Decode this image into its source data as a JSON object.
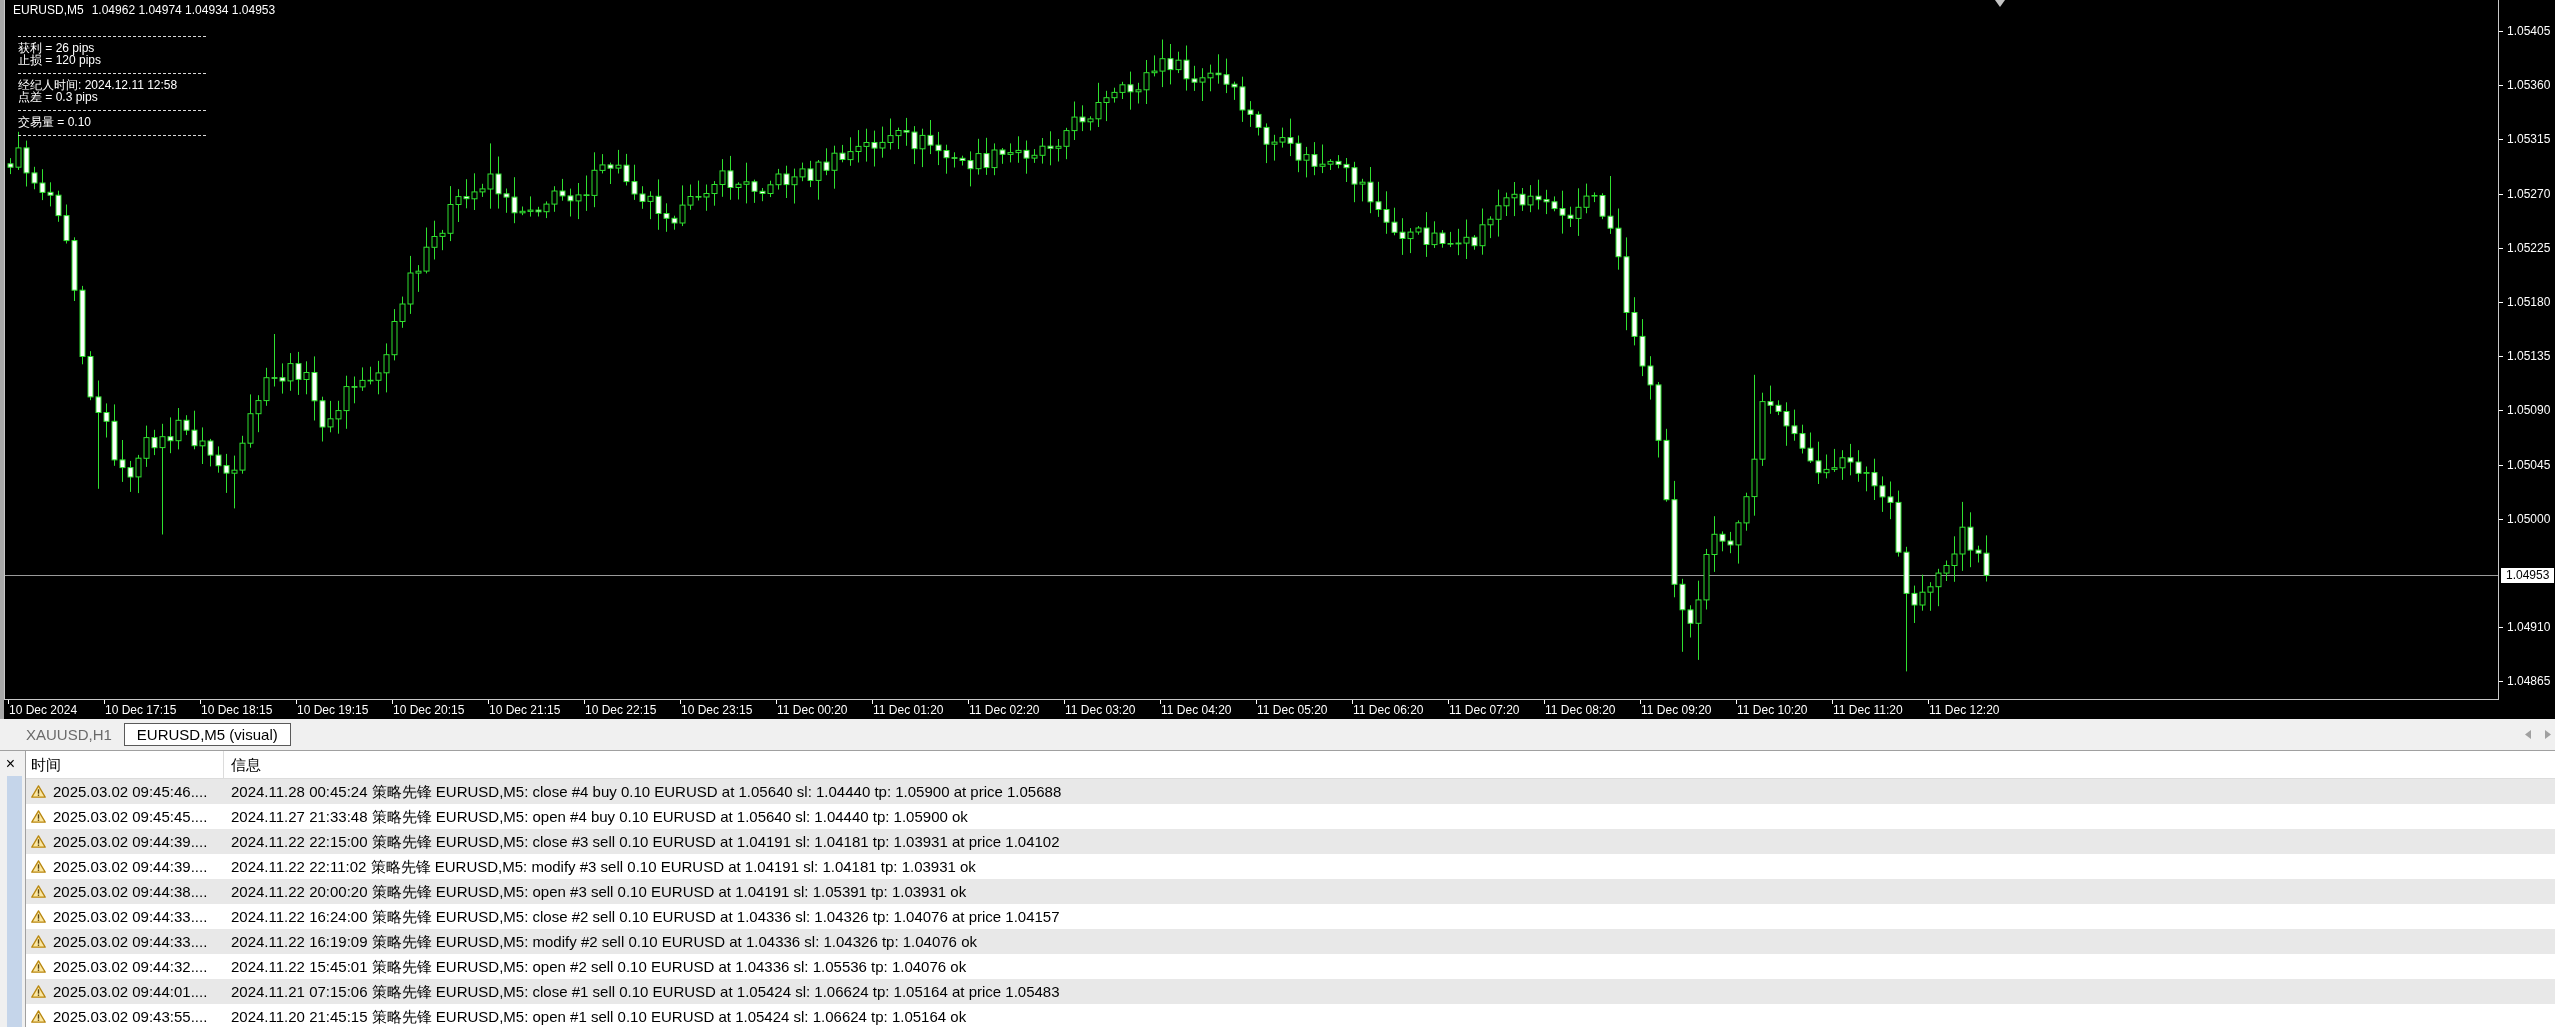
{
  "chart": {
    "symbol": "EURUSD,M5",
    "ohlc": "1.04962 1.04974 1.04934 1.04953",
    "info_groups": [
      [
        "获利 = 26 pips",
        "止损 = 120 pips"
      ],
      [
        "经纪人时间: 2024.12.11 12:58",
        "点差 = 0.3 pips"
      ],
      [
        "交易量 = 0.10"
      ]
    ],
    "price_axis": [
      "1.05405",
      "1.05360",
      "1.05315",
      "1.05270",
      "1.05225",
      "1.05180",
      "1.05135",
      "1.05090",
      "1.05045",
      "1.05000",
      "1.04910",
      "1.04865"
    ],
    "current_price": "1.04953",
    "time_axis": [
      "10 Dec 2024",
      "10 Dec 17:15",
      "10 Dec 18:15",
      "10 Dec 19:15",
      "10 Dec 20:15",
      "10 Dec 21:15",
      "10 Dec 22:15",
      "10 Dec 23:15",
      "11 Dec 00:20",
      "11 Dec 01:20",
      "11 Dec 02:20",
      "11 Dec 03:20",
      "11 Dec 04:20",
      "11 Dec 05:20",
      "11 Dec 06:20",
      "11 Dec 07:20",
      "11 Dec 08:20",
      "11 Dec 09:20",
      "11 Dec 10:20",
      "11 Dec 11:20",
      "11 Dec 12:20"
    ]
  },
  "tabs": [
    {
      "label": "XAUUSD,H1",
      "selected": false
    },
    {
      "label": "EURUSD,M5 (visual)",
      "selected": true
    }
  ],
  "journal": {
    "close_button": "×",
    "columns": [
      "时间",
      "信息"
    ],
    "rows": [
      {
        "time": "2025.03.02 09:45:46....",
        "message": "2024.11.28 00:45:24  策略先锋 EURUSD,M5: close #4 buy 0.10 EURUSD at 1.05640 sl: 1.04440 tp: 1.05900 at price 1.05688"
      },
      {
        "time": "2025.03.02 09:45:45....",
        "message": "2024.11.27 21:33:48  策略先锋 EURUSD,M5: open #4 buy 0.10 EURUSD at 1.05640 sl: 1.04440 tp: 1.05900 ok"
      },
      {
        "time": "2025.03.02 09:44:39....",
        "message": "2024.11.22 22:15:00  策略先锋 EURUSD,M5: close #3 sell 0.10 EURUSD at 1.04191 sl: 1.04181 tp: 1.03931 at price 1.04102"
      },
      {
        "time": "2025.03.02 09:44:39....",
        "message": "2024.11.22 22:11:02  策略先锋 EURUSD,M5: modify #3 sell 0.10 EURUSD at 1.04191 sl: 1.04181 tp: 1.03931 ok"
      },
      {
        "time": "2025.03.02 09:44:38....",
        "message": "2024.11.22 20:00:20  策略先锋 EURUSD,M5: open #3 sell 0.10 EURUSD at 1.04191 sl: 1.05391 tp: 1.03931 ok"
      },
      {
        "time": "2025.03.02 09:44:33....",
        "message": "2024.11.22 16:24:00  策略先锋 EURUSD,M5: close #2 sell 0.10 EURUSD at 1.04336 sl: 1.04326 tp: 1.04076 at price 1.04157"
      },
      {
        "time": "2025.03.02 09:44:33....",
        "message": "2024.11.22 16:19:09  策略先锋 EURUSD,M5: modify #2 sell 0.10 EURUSD at 1.04336 sl: 1.04326 tp: 1.04076 ok"
      },
      {
        "time": "2025.03.02 09:44:32....",
        "message": "2024.11.22 15:45:01  策略先锋 EURUSD,M5: open #2 sell 0.10 EURUSD at 1.04336 sl: 1.05536 tp: 1.04076 ok"
      },
      {
        "time": "2025.03.02 09:44:01....",
        "message": "2024.11.21 07:15:06  策略先锋 EURUSD,M5: close #1 sell 0.10 EURUSD at 1.05424 sl: 1.06624 tp: 1.05164 at price 1.05483"
      },
      {
        "time": "2025.03.02 09:43:55....",
        "message": "2024.11.20 21:45:15  策略先锋 EURUSD,M5: open #1 sell 0.10 EURUSD at 1.05424 sl: 1.06624 tp: 1.05164 ok"
      }
    ]
  }
}
